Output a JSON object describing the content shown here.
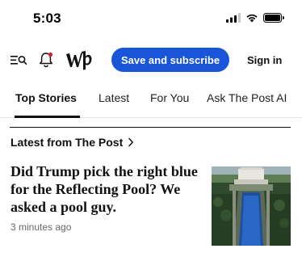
{
  "status_bar": {
    "time": "5:03",
    "icons": [
      "cellular-signal-icon",
      "wifi-icon",
      "battery-icon"
    ]
  },
  "header": {
    "icons": [
      "menu-search-icon",
      "bell-icon",
      "wp-logo"
    ],
    "subscribe_label": "Save and subscribe",
    "signin_label": "Sign in",
    "accent_color": "#1955d8"
  },
  "tabs": [
    {
      "label": "Top Stories",
      "active": true
    },
    {
      "label": "Latest",
      "active": false
    },
    {
      "label": "For You",
      "active": false
    },
    {
      "label": "Ask The Post AI",
      "active": false
    }
  ],
  "section": {
    "title": "Latest from The Post"
  },
  "story": {
    "headline": "Did Trump pick the right blue for the Reflecting Pool? We asked a pool guy.",
    "time_ago": "3 minutes ago"
  }
}
